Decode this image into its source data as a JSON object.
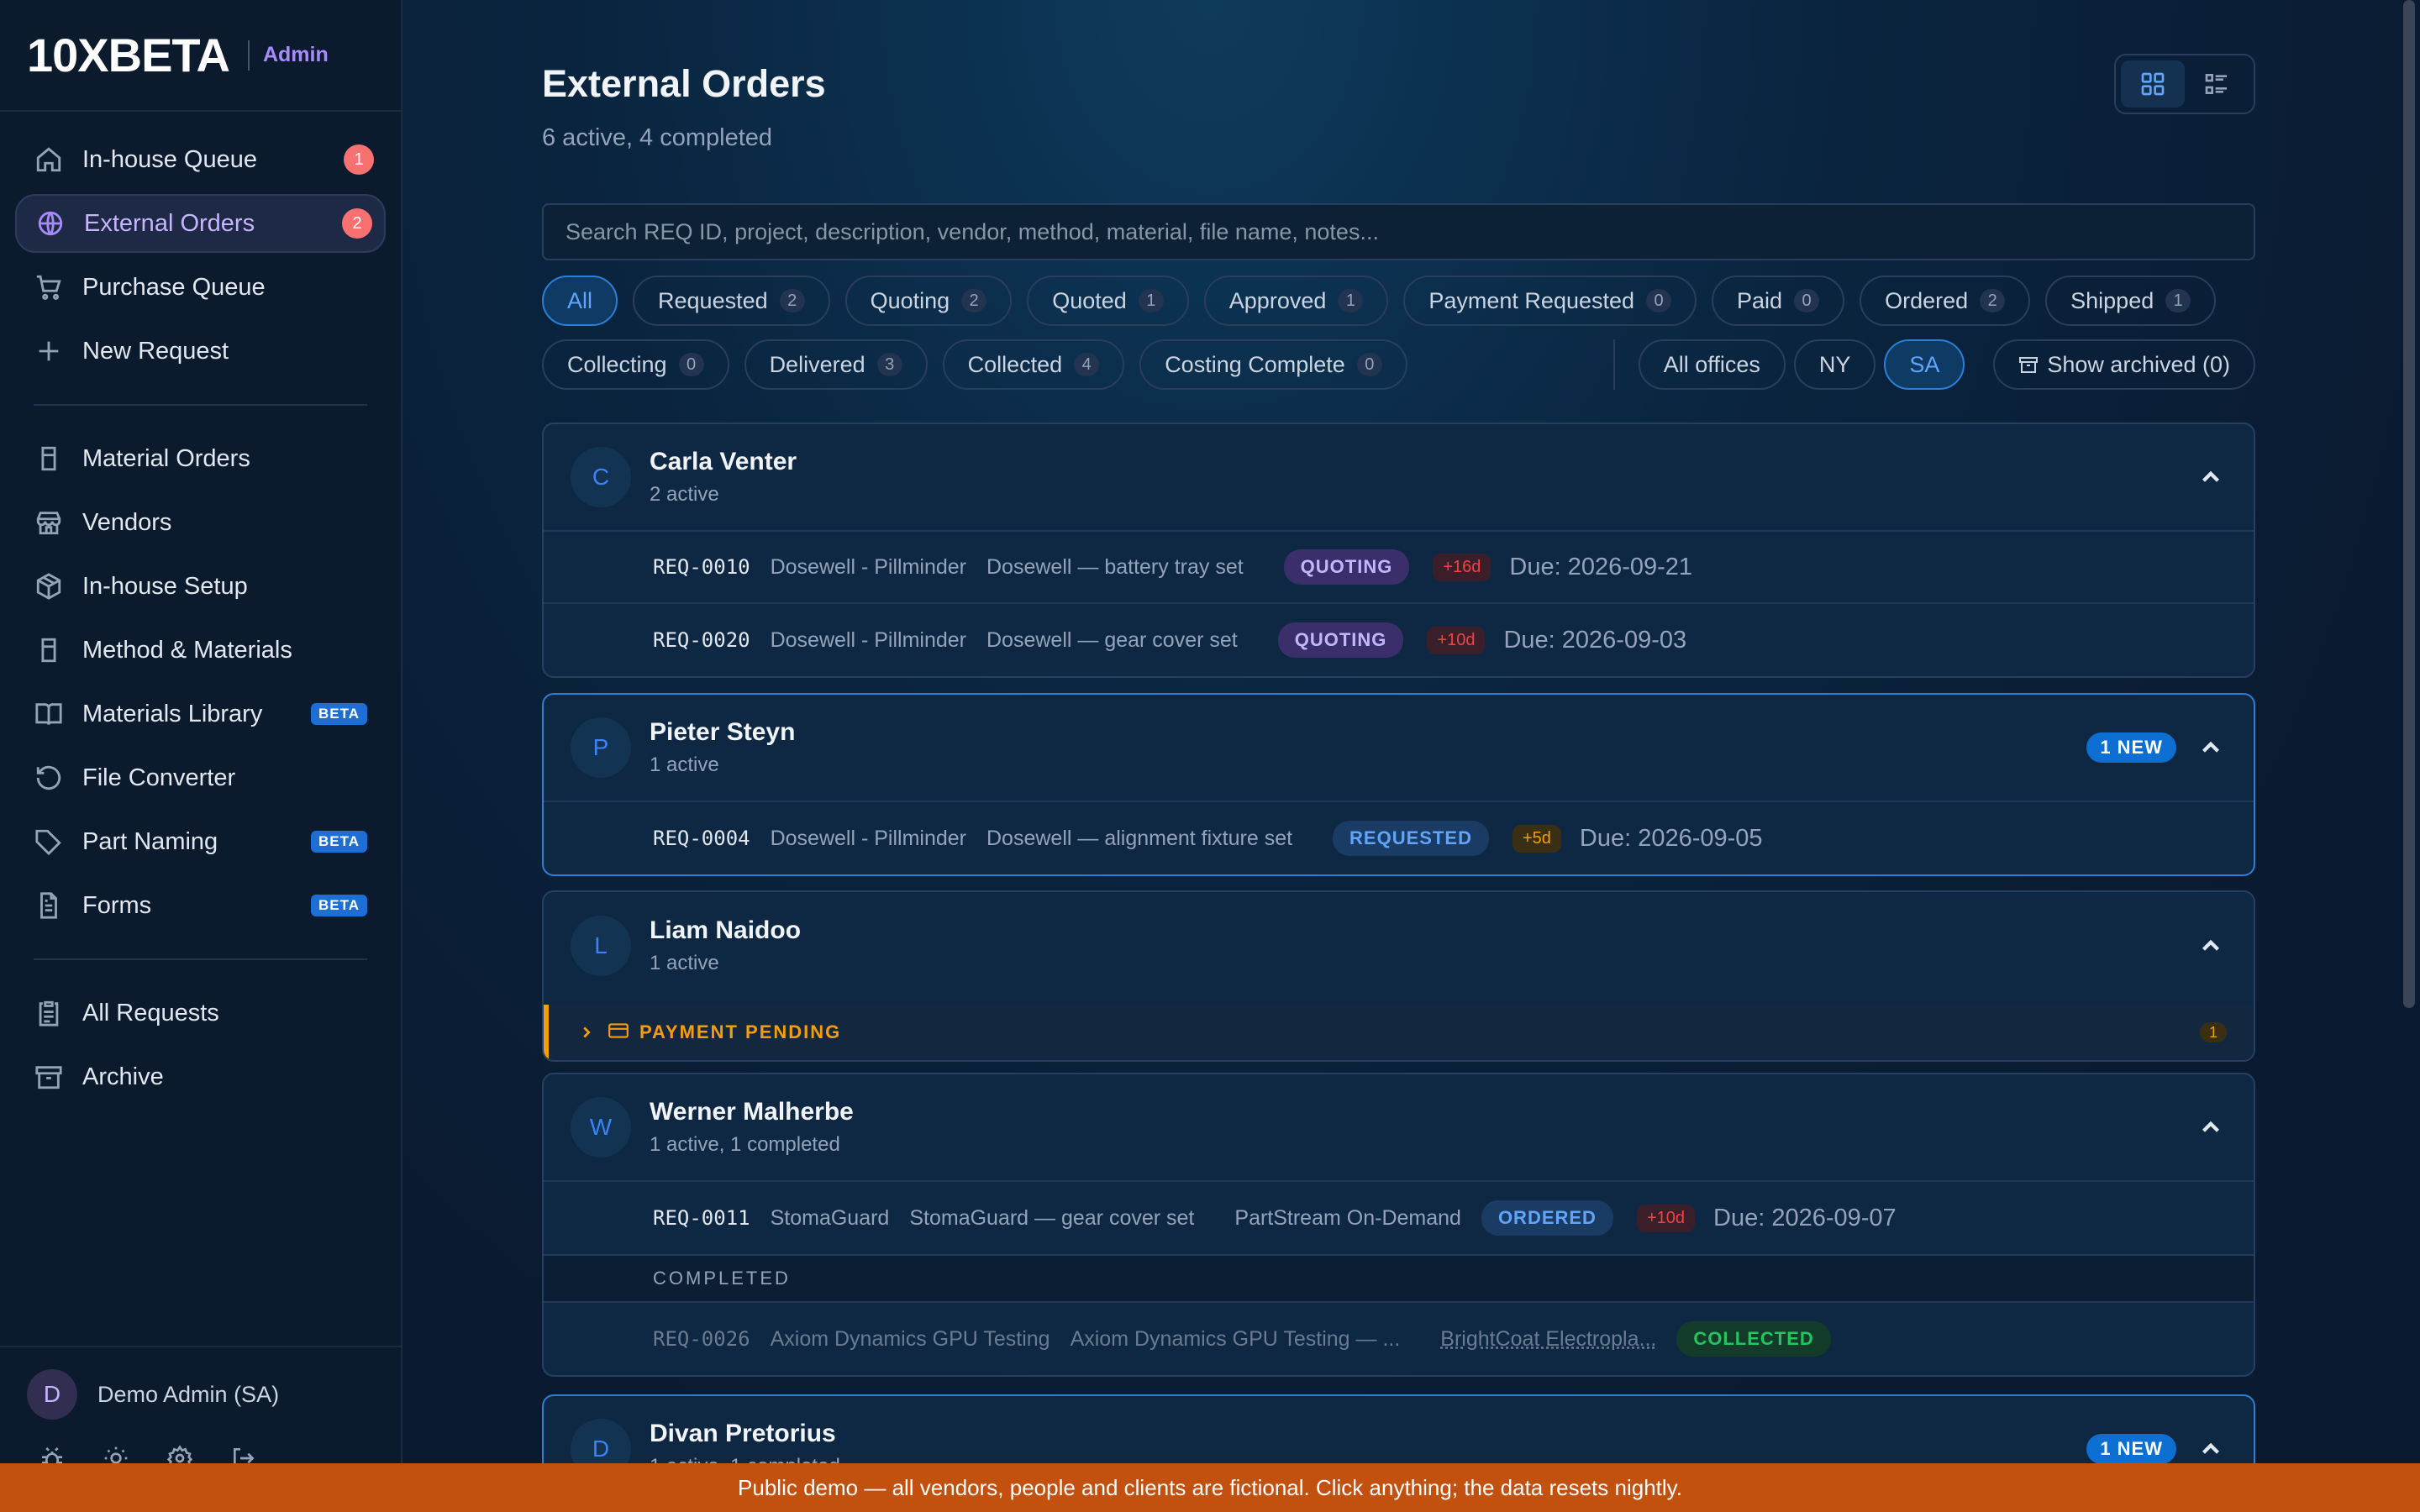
{
  "brand": {
    "logo": "10XBETA",
    "role": "Admin"
  },
  "sidebar": {
    "items": [
      {
        "label": "In-house Queue",
        "icon": "home-icon",
        "badge": "1"
      },
      {
        "label": "External Orders",
        "icon": "globe-icon",
        "badge": "2",
        "active": true
      },
      {
        "label": "Purchase Queue",
        "icon": "cart-icon"
      },
      {
        "label": "New Request",
        "icon": "plus-icon"
      }
    ],
    "items2": [
      {
        "label": "Material Orders",
        "icon": "beaker-icon"
      },
      {
        "label": "Vendors",
        "icon": "store-icon"
      },
      {
        "label": "In-house Setup",
        "icon": "box-icon"
      },
      {
        "label": "Method & Materials",
        "icon": "beaker-icon"
      },
      {
        "label": "Materials Library",
        "icon": "book-icon",
        "beta": "BETA"
      },
      {
        "label": "File Converter",
        "icon": "refresh-icon"
      },
      {
        "label": "Part Naming",
        "icon": "tag-icon",
        "beta": "BETA"
      },
      {
        "label": "Forms",
        "icon": "document-icon",
        "beta": "BETA"
      }
    ],
    "items3": [
      {
        "label": "All Requests",
        "icon": "clipboard-icon"
      },
      {
        "label": "Archive",
        "icon": "archive-icon"
      }
    ],
    "user": {
      "initial": "D",
      "name": "Demo Admin (SA)"
    }
  },
  "header": {
    "title": "External Orders",
    "subtitle": "6 active, 4 completed"
  },
  "search": {
    "placeholder": "Search REQ ID, project, description, vendor, method, material, file name, notes..."
  },
  "filters": {
    "row1": [
      {
        "label": "All",
        "active": true
      },
      {
        "label": "Requested",
        "count": "2"
      },
      {
        "label": "Quoting",
        "count": "2"
      },
      {
        "label": "Quoted",
        "count": "1"
      },
      {
        "label": "Approved",
        "count": "1"
      },
      {
        "label": "Payment Requested",
        "count": "0"
      },
      {
        "label": "Paid",
        "count": "0"
      },
      {
        "label": "Ordered",
        "count": "2"
      },
      {
        "label": "Shipped",
        "count": "1"
      }
    ],
    "row2": [
      {
        "label": "Collecting",
        "count": "0"
      },
      {
        "label": "Delivered",
        "count": "3"
      },
      {
        "label": "Collected",
        "count": "4"
      },
      {
        "label": "Costing Complete",
        "count": "0"
      }
    ],
    "offices": [
      {
        "label": "All offices"
      },
      {
        "label": "NY"
      },
      {
        "label": "SA",
        "active": true
      }
    ],
    "archived": "Show archived (0)"
  },
  "groups": {
    "g1": {
      "initial": "C",
      "name": "Carla Venter",
      "meta": "2 active",
      "rows": [
        {
          "req": "REQ-0010",
          "project": "Dosewell - Pillminder",
          "desc": "Dosewell — battery tray set",
          "status": "QUOTING",
          "overdue": "+16d",
          "due": "Due: 2026-09-21"
        },
        {
          "req": "REQ-0020",
          "project": "Dosewell - Pillminder",
          "desc": "Dosewell — gear cover set",
          "status": "QUOTING",
          "overdue": "+10d",
          "due": "Due: 2026-09-03"
        }
      ]
    },
    "g2": {
      "initial": "P",
      "name": "Pieter Steyn",
      "meta": "1 active",
      "new": "1 NEW",
      "rows": [
        {
          "req": "REQ-0004",
          "project": "Dosewell - Pillminder",
          "desc": "Dosewell — alignment fixture set",
          "status": "REQUESTED",
          "overdue": "+5d",
          "due": "Due: 2026-09-05"
        }
      ]
    },
    "g3": {
      "initial": "L",
      "name": "Liam Naidoo",
      "meta": "1 active",
      "pending": {
        "label": "PAYMENT PENDING",
        "count": "1"
      }
    },
    "g4": {
      "initial": "W",
      "name": "Werner Malherbe",
      "meta": "1 active, 1 completed",
      "rows": [
        {
          "req": "REQ-0011",
          "project": "StomaGuard",
          "desc": "StomaGuard — gear cover set",
          "vendor": "PartStream On-Demand",
          "status": "ORDERED",
          "overdue": "+10d",
          "due": "Due: 2026-09-07"
        }
      ],
      "completed_label": "COMPLETED",
      "completed": [
        {
          "req": "REQ-0026",
          "project": "Axiom Dynamics GPU Testing",
          "desc": "Axiom Dynamics GPU Testing — ...",
          "vendor": "BrightCoat Electropla...",
          "status": "COLLECTED"
        }
      ]
    },
    "g5": {
      "initial": "D",
      "name": "Divan Pretorius",
      "meta": "1 active, 1 completed",
      "new": "1 NEW"
    }
  },
  "banner": "Public demo — all vendors, people and clients are fictional. Click anything; the data resets nightly.",
  "colors": {
    "accent": "#60a5fa",
    "violet": "#a78bfa",
    "warning": "#f59e0b",
    "danger": "#ef4444",
    "banner": "#c2500f"
  }
}
